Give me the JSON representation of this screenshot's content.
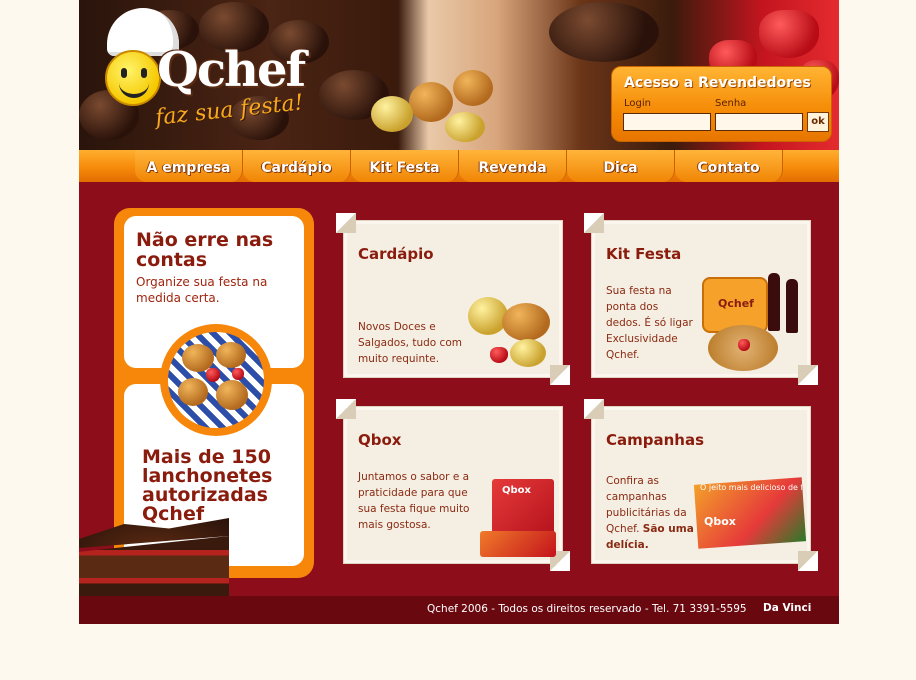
{
  "brand": {
    "name": "Qchef",
    "tagline": "faz sua festa!"
  },
  "login": {
    "title": "Acesso a Revendedores",
    "login_label": "Login",
    "password_label": "Senha",
    "login_value": "",
    "password_value": "",
    "submit_label": "ok"
  },
  "nav": {
    "items": [
      {
        "label": "A empresa"
      },
      {
        "label": "Cardápio"
      },
      {
        "label": "Kit Festa"
      },
      {
        "label": "Revenda"
      },
      {
        "label": "Dica"
      },
      {
        "label": "Contato"
      }
    ]
  },
  "promo": {
    "heading": "Não erre nas contas",
    "subheading": "Organize sua festa na medida certa.",
    "count_text": "Mais de 150 lanchonetes autorizadas Qchef"
  },
  "cards": [
    {
      "title": "Cardápio",
      "text": "Novos Doces e Salgados, tudo com muito requinte."
    },
    {
      "title": "Kit Festa",
      "text": "Sua festa na ponta dos dedos. É só ligar Exclusividade Qchef."
    },
    {
      "title": "Qbox",
      "text": "Juntamos o sabor e a praticidade para que sua festa fique muito mais gostosa."
    },
    {
      "title": "Campanhas",
      "text": "Confira as campanhas publicitárias da Qchef.",
      "highlight": "São uma delícia."
    }
  ],
  "product_labels": {
    "kit_box": "Qchef",
    "qbox_box": "Qbox",
    "campaign_banner": "O jeito mais delicioso de festejar.",
    "campaign_box": "Qbox"
  },
  "footer": {
    "copyright": "Qchef 2006 - Todos os direitos reservado - Tel. 71 3391-5595",
    "credit": "Da Vinci"
  },
  "colors": {
    "brand_red": "#8e0d1a",
    "brand_orange": "#f7870a",
    "text_brown": "#8a1c0d"
  }
}
